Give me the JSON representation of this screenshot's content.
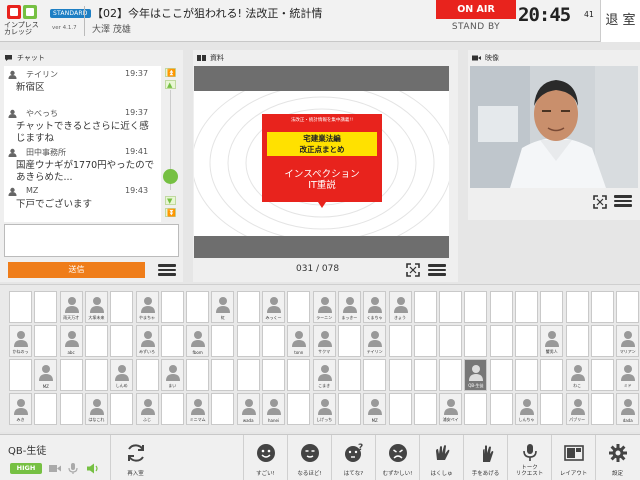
{
  "header": {
    "logo_text": "インプレス\nカレッジ",
    "brand": "STANDARD",
    "version": "ver 4.1.7",
    "lecture_title": "【02】今年はここが狙われる! 法改正・統計情",
    "teacher": "大澤 茂雄",
    "onair": "ON AIR",
    "standby": "STAND BY",
    "clock": "20:45",
    "clock_sec": "41",
    "exit_label": "退 室"
  },
  "chat": {
    "title": "チャット",
    "messages": [
      {
        "name": "テイリン",
        "time": "19:37",
        "text": "新宿区"
      },
      {
        "name": "やべっち",
        "time": "19:37",
        "text": "チャットできるとさらに近く感じますね"
      },
      {
        "name": "田中事務所",
        "time": "19:41",
        "text": "国産ウナギが1770円やったのであきらめた..."
      },
      {
        "name": "MZ",
        "time": "19:43",
        "text": "下戸でございます"
      }
    ],
    "input_value": "",
    "send_label": "送信"
  },
  "materials": {
    "title": "資料",
    "slide_tag": "法改正・統計情報を集中講義!!",
    "slide_heading": "宅建業法編\n改正点まとめ",
    "slide_sub": "インスペクション\nIT重説",
    "page_current": "031",
    "page_total": "078",
    "page_display": "031 / 078"
  },
  "video": {
    "title": "映像"
  },
  "seats": {
    "rows": [
      [
        {
          "name": "",
          "occupied": false
        },
        {
          "name": "",
          "occupied": false
        },
        {
          "name": "雨天万才",
          "occupied": true
        },
        {
          "name": "大塚未来",
          "occupied": true
        },
        {
          "name": "",
          "occupied": false
        },
        {
          "name": "やまちゃ",
          "occupied": true
        },
        {
          "name": "",
          "occupied": false
        },
        {
          "name": "",
          "occupied": false
        },
        {
          "name": "虹",
          "occupied": true
        },
        {
          "name": "",
          "occupied": false
        },
        {
          "name": "みっくー",
          "occupied": true
        },
        {
          "name": "",
          "occupied": false
        },
        {
          "name": "ラーニン",
          "occupied": true
        },
        {
          "name": "まっきー",
          "occupied": true
        },
        {
          "name": "くまちゃ",
          "occupied": true
        },
        {
          "name": "きょう",
          "occupied": true
        },
        {
          "name": "",
          "occupied": false
        },
        {
          "name": "",
          "occupied": false
        },
        {
          "name": "",
          "occupied": false
        },
        {
          "name": "",
          "occupied": false
        },
        {
          "name": "",
          "occupied": false
        },
        {
          "name": "",
          "occupied": false
        },
        {
          "name": "",
          "occupied": false
        },
        {
          "name": "",
          "occupied": false
        },
        {
          "name": "",
          "occupied": false
        }
      ],
      [
        {
          "name": "かねのっ",
          "occupied": true
        },
        {
          "name": "",
          "occupied": false
        },
        {
          "name": "abc",
          "occupied": true
        },
        {
          "name": "",
          "occupied": false
        },
        {
          "name": "",
          "occupied": false
        },
        {
          "name": "みずいろ",
          "occupied": true
        },
        {
          "name": "",
          "occupied": false
        },
        {
          "name": "fbom",
          "occupied": true
        },
        {
          "name": "",
          "occupied": false
        },
        {
          "name": "",
          "occupied": false
        },
        {
          "name": "",
          "occupied": false
        },
        {
          "name": "tonn",
          "occupied": true
        },
        {
          "name": "サクマ",
          "occupied": true
        },
        {
          "name": "",
          "occupied": false
        },
        {
          "name": "テイリン",
          "occupied": true
        },
        {
          "name": "",
          "occupied": false
        },
        {
          "name": "",
          "occupied": false
        },
        {
          "name": "",
          "occupied": false
        },
        {
          "name": "",
          "occupied": false
        },
        {
          "name": "",
          "occupied": false
        },
        {
          "name": "",
          "occupied": false
        },
        {
          "name": "蟹男人",
          "occupied": true
        },
        {
          "name": "",
          "occupied": false
        },
        {
          "name": "",
          "occupied": false
        },
        {
          "name": "マリアン",
          "occupied": true
        }
      ],
      [
        {
          "name": "",
          "occupied": false
        },
        {
          "name": "MZ",
          "occupied": true
        },
        {
          "name": "",
          "occupied": false
        },
        {
          "name": "",
          "occupied": false
        },
        {
          "name": "しんめ",
          "occupied": true
        },
        {
          "name": "",
          "occupied": false
        },
        {
          "name": "まい",
          "occupied": true
        },
        {
          "name": "",
          "occupied": false
        },
        {
          "name": "",
          "occupied": false
        },
        {
          "name": "",
          "occupied": false
        },
        {
          "name": "",
          "occupied": false
        },
        {
          "name": "",
          "occupied": false
        },
        {
          "name": "こまき",
          "occupied": true
        },
        {
          "name": "",
          "occupied": false
        },
        {
          "name": "",
          "occupied": false
        },
        {
          "name": "",
          "occupied": false
        },
        {
          "name": "",
          "occupied": false
        },
        {
          "name": "",
          "occupied": false
        },
        {
          "name": "QB-生徒",
          "occupied": true,
          "me": true
        },
        {
          "name": "",
          "occupied": false
        },
        {
          "name": "",
          "occupied": false
        },
        {
          "name": "",
          "occupied": false
        },
        {
          "name": "わこ",
          "occupied": true
        },
        {
          "name": "",
          "occupied": false
        },
        {
          "name": "ミド",
          "occupied": true
        }
      ],
      [
        {
          "name": "みき",
          "occupied": true
        },
        {
          "name": "",
          "occupied": false
        },
        {
          "name": "",
          "occupied": false
        },
        {
          "name": "はなこれ",
          "occupied": true
        },
        {
          "name": "",
          "occupied": false
        },
        {
          "name": "ふじ",
          "occupied": true
        },
        {
          "name": "",
          "occupied": false
        },
        {
          "name": "ミニマム",
          "occupied": true
        },
        {
          "name": "",
          "occupied": false
        },
        {
          "name": "wada",
          "occupied": true
        },
        {
          "name": "hanei",
          "occupied": true
        },
        {
          "name": "",
          "occupied": false
        },
        {
          "name": "しげっち",
          "occupied": true
        },
        {
          "name": "",
          "occupied": false
        },
        {
          "name": "MZ",
          "occupied": true
        },
        {
          "name": "",
          "occupied": false
        },
        {
          "name": "",
          "occupied": false
        },
        {
          "name": "浦安ペイ",
          "occupied": true
        },
        {
          "name": "",
          "occupied": false
        },
        {
          "name": "",
          "occupied": false
        },
        {
          "name": "しんちゃ",
          "occupied": true
        },
        {
          "name": "",
          "occupied": false
        },
        {
          "name": "パブリー",
          "occupied": true
        },
        {
          "name": "",
          "occupied": false
        },
        {
          "name": "dada",
          "occupied": true
        }
      ]
    ]
  },
  "bottom": {
    "student_name": "QB-生徒",
    "quality": "HIGH",
    "reenter_label": "再入室",
    "reactions": [
      {
        "key": "sugoi",
        "label": "すごい!"
      },
      {
        "key": "naruhodo",
        "label": "なるほど!"
      },
      {
        "key": "hatena",
        "label": "はてな?"
      },
      {
        "key": "muzukashii",
        "label": "むずかしい!"
      },
      {
        "key": "hakushu",
        "label": "はくしゅ"
      },
      {
        "key": "teage",
        "label": "手をあげる"
      },
      {
        "key": "talk",
        "label": "トーク\nリクエスト"
      },
      {
        "key": "layout",
        "label": "レイアウト"
      },
      {
        "key": "settings",
        "label": "設定"
      }
    ]
  },
  "colors": {
    "onair_red": "#e8231d",
    "send_orange": "#ef7d1a",
    "accent_green": "#76c043",
    "brand_blue": "#1e7fc4"
  }
}
